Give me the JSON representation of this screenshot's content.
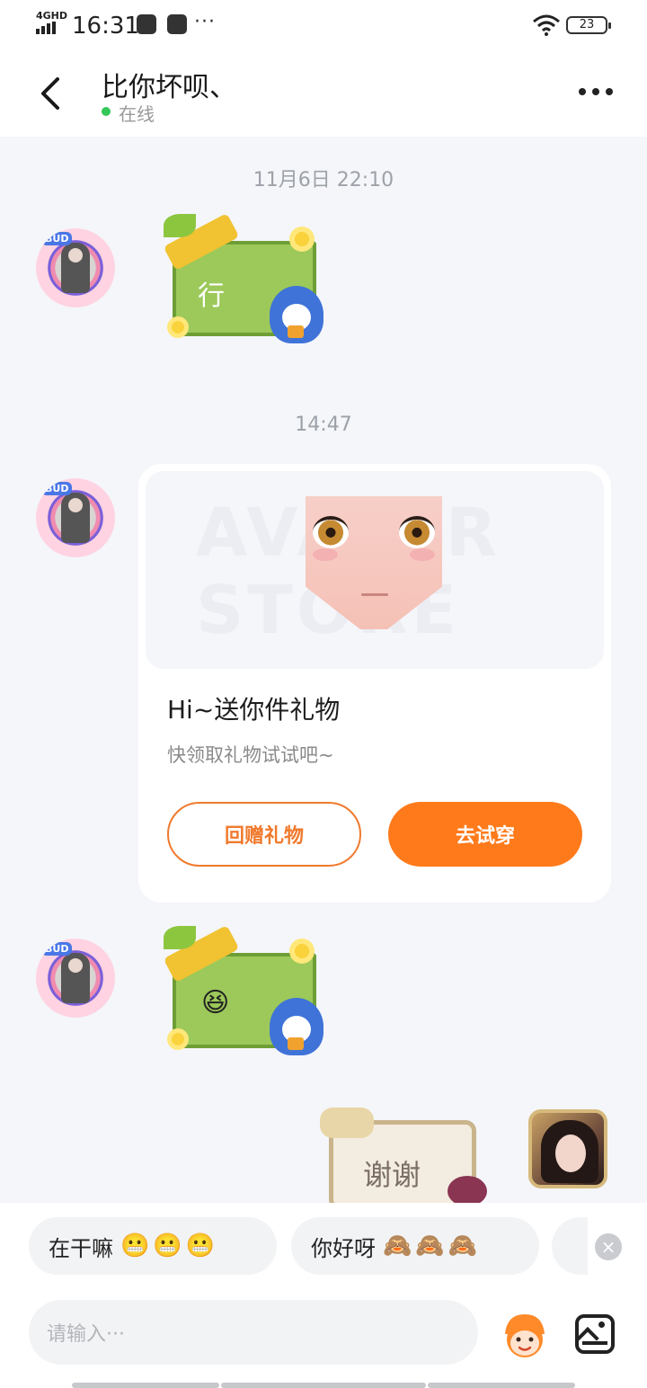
{
  "status_bar": {
    "network": "4GHD",
    "time": "16:31",
    "battery": "23"
  },
  "header": {
    "contact_name": "比你坏呗、",
    "status": "在线"
  },
  "chat": {
    "timestamps": [
      "11月6日 22:10",
      "14:47"
    ],
    "messages": [
      {
        "from": "other",
        "type": "sticker",
        "text": "行"
      },
      {
        "from": "other",
        "type": "gift_card",
        "title": "Hi~送你件礼物",
        "subtitle": "快领取礼物试试吧~",
        "button_secondary": "回赠礼物",
        "button_primary": "去试穿",
        "watermark": "AVATAR STORE"
      },
      {
        "from": "other",
        "type": "sticker",
        "emoji": "😆"
      },
      {
        "from": "me",
        "type": "sticker",
        "text": "谢谢"
      }
    ]
  },
  "quick_replies": [
    {
      "text": "在干嘛",
      "emoji": "😬😬😬"
    },
    {
      "text": "你好呀",
      "emoji": "🙈🙈🙈"
    }
  ],
  "input": {
    "placeholder": "请输入···"
  },
  "colors": {
    "accent": "#ff7a1a",
    "online": "#35c759",
    "background": "#f4f6fa"
  }
}
